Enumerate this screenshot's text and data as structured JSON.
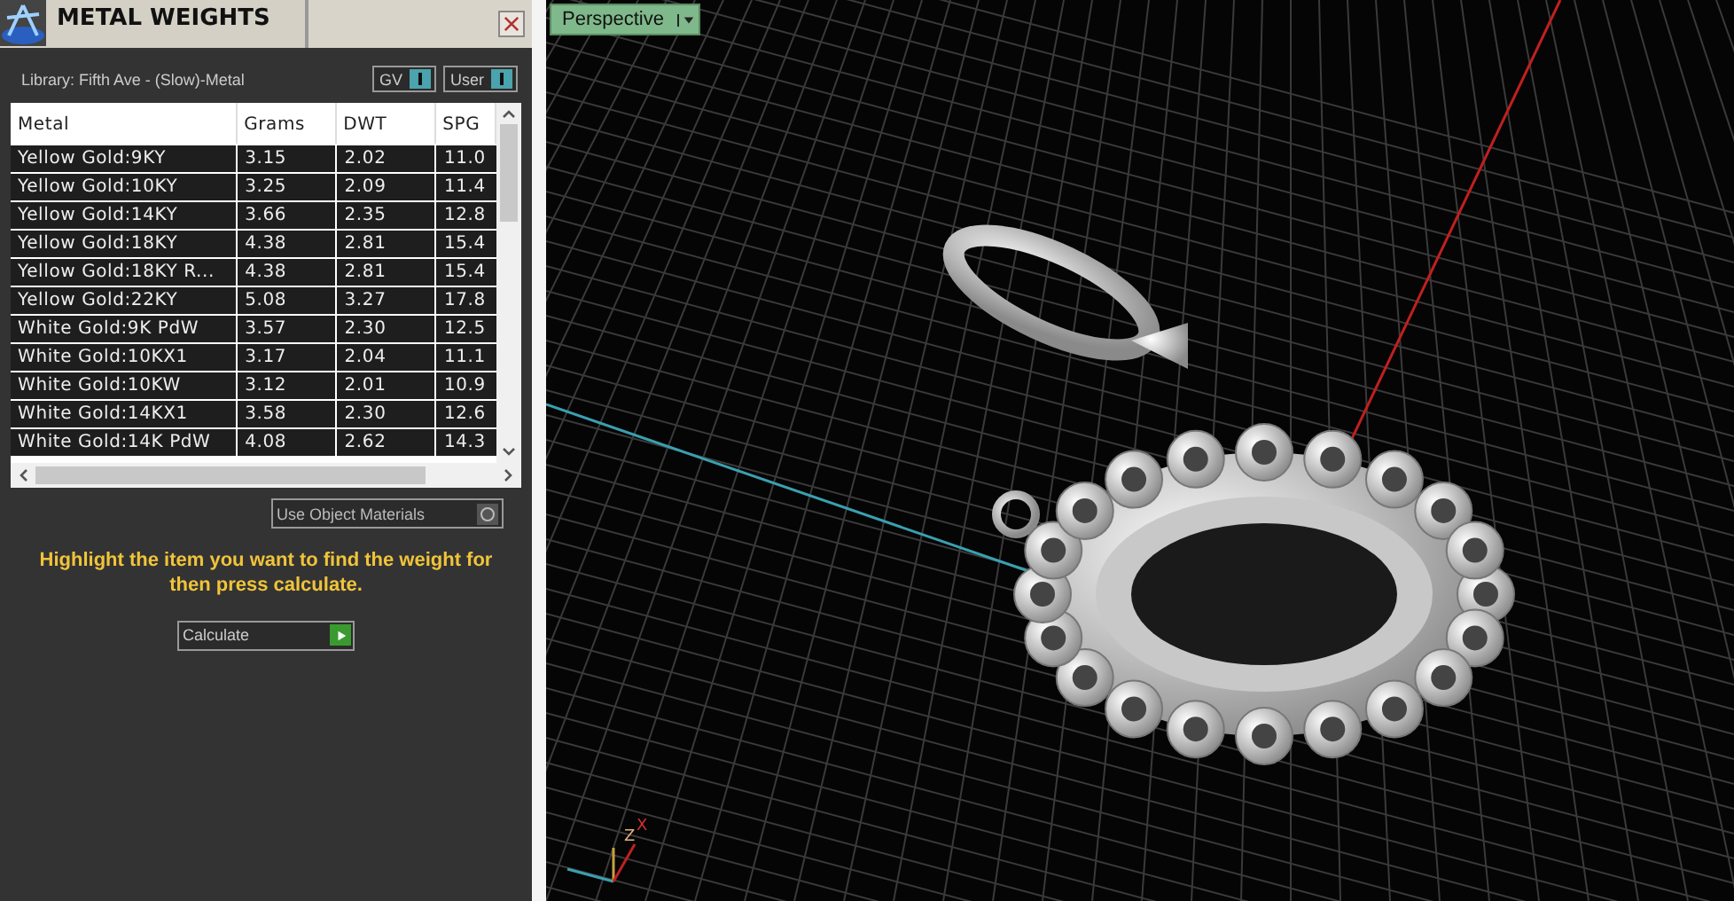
{
  "panel": {
    "title": "METAL WEIGHTS",
    "library": "Library: Fifth Ave - (Slow)-Metal",
    "toggles": [
      {
        "label": "GV",
        "on": true
      },
      {
        "label": "User",
        "on": true
      }
    ],
    "table": {
      "columns": [
        "Metal",
        "Grams",
        "DWT",
        "SPG"
      ],
      "rows": [
        [
          "Yellow Gold:9KY",
          "3.15",
          "2.02",
          "11.0"
        ],
        [
          "Yellow Gold:10KY",
          "3.25",
          "2.09",
          "11.4"
        ],
        [
          "Yellow Gold:14KY",
          "3.66",
          "2.35",
          "12.8"
        ],
        [
          "Yellow Gold:18KY",
          "4.38",
          "2.81",
          "15.4"
        ],
        [
          "Yellow Gold:18KY R...",
          "4.38",
          "2.81",
          "15.4"
        ],
        [
          "Yellow Gold:22KY",
          "5.08",
          "3.27",
          "17.8"
        ],
        [
          "White Gold:9K PdW",
          "3.57",
          "2.30",
          "12.5"
        ],
        [
          "White Gold:10KX1",
          "3.17",
          "2.04",
          "11.1"
        ],
        [
          "White Gold:10KW",
          "3.12",
          "2.01",
          "10.9"
        ],
        [
          "White Gold:14KX1",
          "3.58",
          "2.30",
          "12.6"
        ],
        [
          "White Gold:14K PdW",
          "4.08",
          "2.62",
          "14.3"
        ]
      ]
    },
    "materials_toggle": {
      "label": "Use Object Materials",
      "on": false
    },
    "hint": "Highlight the item you want to find the weight for then press calculate.",
    "calculate_button": "Calculate"
  },
  "viewport": {
    "view_menu": "Perspective",
    "axis_labels": [
      "Z",
      "X"
    ]
  }
}
